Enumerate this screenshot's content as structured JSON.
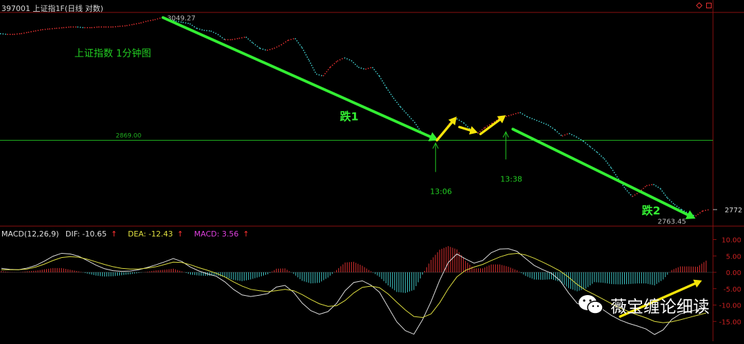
{
  "header": {
    "code": "397001",
    "name": "上证指1F",
    "mode": "(日线 对数)"
  },
  "corner_icons": [
    "diamond-icon",
    "restore-icon"
  ],
  "chart_data": [
    {
      "type": "line",
      "title": "上证指数 1分钟图",
      "y_scale": "log",
      "ylim": [
        2755,
        3055
      ],
      "high_label": "3049.27",
      "low_label": "2763.45",
      "last_value": "2772",
      "reference_line": {
        "label": "2869.00",
        "value": 2869.0
      },
      "time_marks": [
        {
          "label": "13:06",
          "price": 2869
        },
        {
          "label": "13:38",
          "price": 2885
        }
      ],
      "arrows_green": [
        {
          "label": "跌1",
          "from": 3049.27,
          "to": 2869
        },
        {
          "label": "跌2",
          "from": 2885,
          "to": 2763.45
        }
      ],
      "series": [
        {
          "values": [
            3025,
            3024,
            3024,
            3025,
            3027,
            3029,
            3031,
            3032,
            3033,
            3034,
            3035,
            3035,
            3034,
            3034,
            3035,
            3035,
            3035,
            3036,
            3037,
            3039,
            3041,
            3044,
            3046,
            3049,
            3046,
            3044,
            3042,
            3040,
            3033,
            3030,
            3029,
            3024,
            3016,
            3016,
            3018,
            3020,
            3011,
            3003,
            3000,
            3003,
            3008,
            3015,
            3018,
            3004,
            2985,
            2965,
            2962,
            2975,
            2984,
            2989,
            2985,
            2975,
            2972,
            2975,
            2962,
            2945,
            2930,
            2917,
            2906,
            2895,
            2880,
            2875,
            2869,
            2880,
            2893,
            2900,
            2894,
            2884,
            2879,
            2887,
            2893,
            2900,
            2903,
            2906,
            2909,
            2903,
            2899,
            2895,
            2891,
            2884,
            2875,
            2879,
            2874,
            2868,
            2860,
            2852,
            2843,
            2830,
            2815,
            2801,
            2790,
            2796,
            2805,
            2807,
            2801,
            2788,
            2779,
            2772,
            2767,
            2763,
            2770,
            2772
          ]
        }
      ]
    },
    {
      "type": "bar",
      "title": "",
      "indicator": "MACD(12,26,9)",
      "dif_label": "DIF: -10.65",
      "dea_label": "DEA: -12.43",
      "macd_label": "MACD: 3.56",
      "ylim": [
        -20,
        12
      ],
      "yticks": [
        "10.00",
        "5.00",
        "0.00",
        "-5.00",
        "-10.00",
        "-15.00"
      ],
      "ytick_values": [
        10,
        5,
        0,
        -5,
        -10,
        -15
      ],
      "series": [
        {
          "name": "DIF",
          "values": [
            1.2,
            0.9,
            0.8,
            1.3,
            2.1,
            3.4,
            4.9,
            5.8,
            5.6,
            4.9,
            3.6,
            2.2,
            1.1,
            0.5,
            0.3,
            0.4,
            0.8,
            1.5,
            2.3,
            3.2,
            4.2,
            3.3,
            1.6,
            0.4,
            -0.5,
            -1.2,
            -2.9,
            -5.2,
            -6.9,
            -7.4,
            -7.0,
            -6.5,
            -4.5,
            -4.0,
            -6.1,
            -9.4,
            -11.7,
            -12.8,
            -12.0,
            -9.5,
            -5.6,
            -3.1,
            -2.6,
            -3.9,
            -6.1,
            -10.6,
            -15.1,
            -17.8,
            -18.9,
            -14.5,
            -8.9,
            -2.4,
            3.0,
            5.6,
            4.1,
            2.8,
            3.6,
            6.0,
            7.1,
            7.2,
            6.4,
            4.2,
            2.1,
            0.8,
            -0.3,
            -2.5,
            -6.3,
            -9.5,
            -10.5,
            -9.8,
            -11.4,
            -13.2,
            -14.6,
            -15.6,
            -16.4,
            -17.3,
            -19.0,
            -17.6,
            -14.4,
            -12.7,
            -12.0,
            -11.4,
            -10.65
          ]
        },
        {
          "name": "DEA",
          "values": [
            0.8,
            0.8,
            0.8,
            1.0,
            1.6,
            2.5,
            3.6,
            4.5,
            4.8,
            4.6,
            4.0,
            3.2,
            2.4,
            1.7,
            1.2,
            1.0,
            1.0,
            1.3,
            1.7,
            2.4,
            3.1,
            3.0,
            2.3,
            1.4,
            0.6,
            -0.3,
            -1.4,
            -2.9,
            -4.2,
            -5.2,
            -5.6,
            -5.9,
            -5.6,
            -5.2,
            -5.6,
            -6.8,
            -8.3,
            -9.6,
            -10.4,
            -10.2,
            -8.6,
            -6.3,
            -4.6,
            -4.2,
            -4.7,
            -6.6,
            -9.1,
            -11.5,
            -13.5,
            -13.8,
            -12.7,
            -9.3,
            -5.0,
            -1.4,
            0.6,
            1.6,
            2.4,
            3.6,
            4.7,
            5.5,
            5.8,
            5.3,
            4.3,
            3.1,
            1.8,
            0.4,
            -1.5,
            -3.7,
            -5.5,
            -6.8,
            -8.2,
            -9.6,
            -10.9,
            -12.0,
            -13.0,
            -13.9,
            -15.0,
            -15.4,
            -15.1,
            -14.5,
            -13.8,
            -13.1,
            -12.43
          ]
        },
        {
          "name": "MACD",
          "values": [
            0.4,
            0.1,
            0.0,
            0.3,
            0.5,
            0.9,
            1.3,
            1.3,
            0.8,
            0.3,
            -0.4,
            -1.0,
            -1.3,
            -1.2,
            -0.9,
            -0.6,
            -0.2,
            0.2,
            0.6,
            0.8,
            1.1,
            0.3,
            -0.7,
            -1.0,
            -1.1,
            -0.9,
            -1.5,
            -2.3,
            -2.7,
            -2.2,
            -1.4,
            -0.6,
            1.1,
            1.2,
            -0.5,
            -2.6,
            -3.4,
            -3.2,
            -1.6,
            0.7,
            3.0,
            3.2,
            2.0,
            0.3,
            -1.4,
            -4.0,
            -6.0,
            -6.3,
            -5.4,
            -0.7,
            3.8,
            6.9,
            8.0,
            7.0,
            3.5,
            1.2,
            1.2,
            2.4,
            2.4,
            1.7,
            0.6,
            -1.1,
            -2.2,
            -2.3,
            -2.1,
            -2.9,
            -4.8,
            -5.8,
            -5.0,
            -3.0,
            -3.2,
            -3.6,
            -3.7,
            -3.6,
            -3.4,
            -3.4,
            -4.0,
            -2.2,
            0.7,
            1.8,
            1.8,
            1.7,
            3.56
          ]
        }
      ]
    }
  ],
  "watermark": {
    "text": "薇宝缠论细读"
  },
  "colors": {
    "background": "#000000",
    "price_up": "#e03030",
    "price_down": "#40c8c8",
    "reference_line": "#20b020",
    "green_arrow": "#33ee33",
    "yellow_arrow": "#f4e40a",
    "macd_positive": "#e03030",
    "macd_negative": "#40c8c8",
    "dif_line": "#e0e0e0",
    "dea_line": "#e0e040",
    "frame": "#8b1010"
  }
}
